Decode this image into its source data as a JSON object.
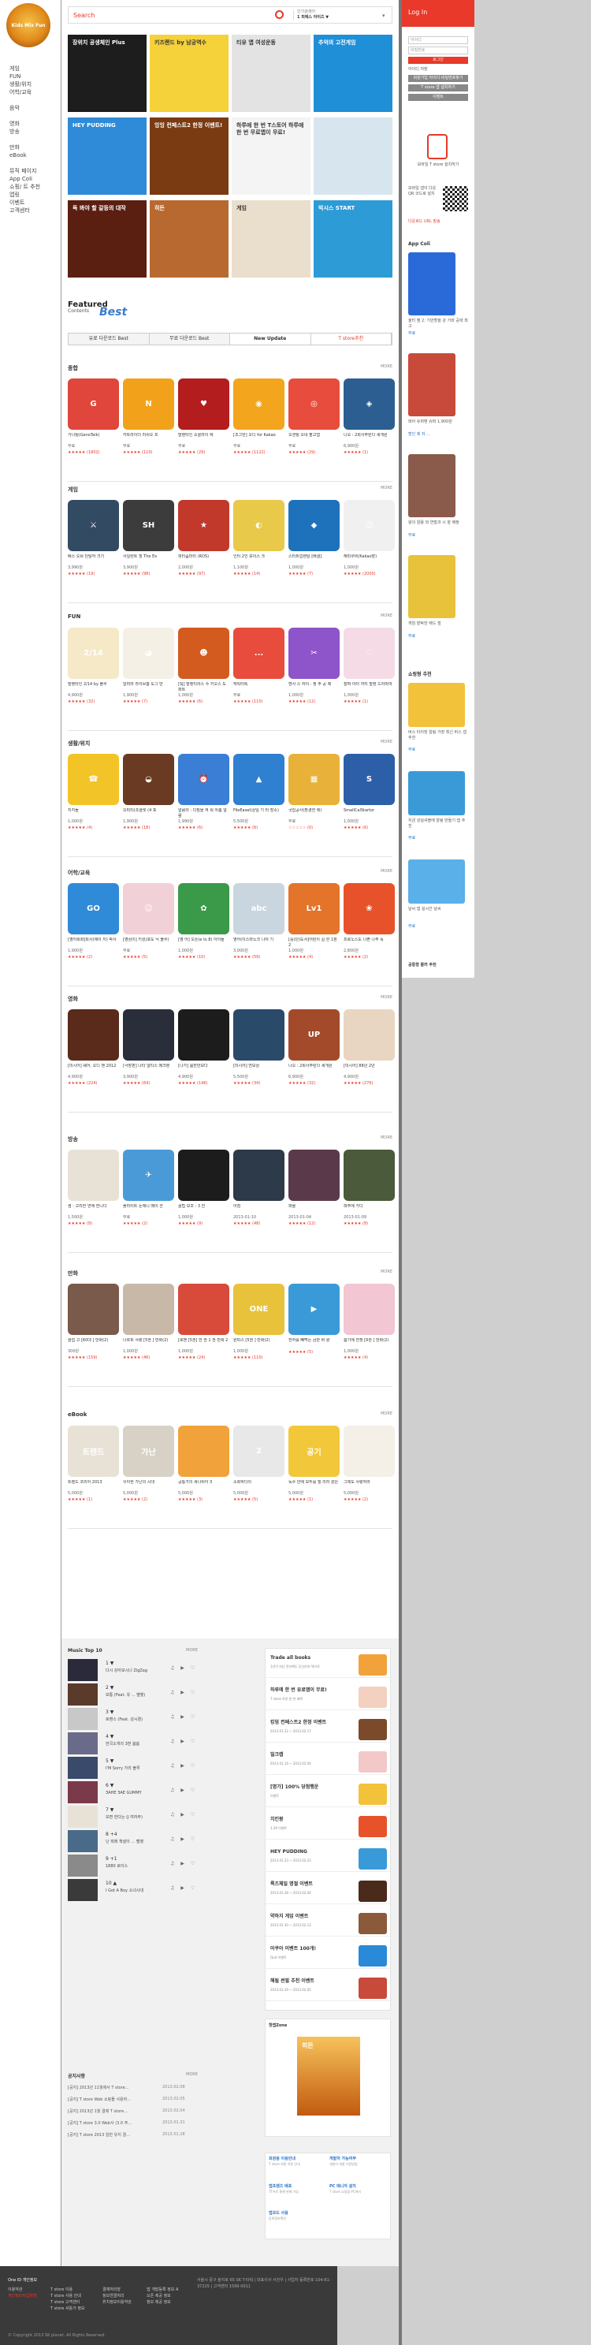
{
  "left_nav": {
    "logo_text": "Kids Mix Fun",
    "items": [
      "게임",
      "FUN",
      "생활/위치",
      "어학/교육"
    ],
    "items2": [
      "음악",
      "영화",
      "방송"
    ],
    "items3": [
      "만화",
      "eBook"
    ],
    "items4": [
      "뮤직 페이지",
      "App Coli",
      "쇼핑/ 트 추천",
      "앱링",
      "이벤트",
      "고객센터"
    ]
  },
  "search": {
    "placeholder": "Search",
    "popular_label": "인기검색어",
    "popular_value": "1 피에스 아이즈 ▼"
  },
  "banners": [
    {
      "text": "장위치 공생체인 Plus",
      "color": "#1d1d1d"
    },
    {
      "text": "키즈랜드 by 남궁역수",
      "color": "#f5d13a"
    },
    {
      "text": "티유 앱 여성운동",
      "color": "#e3e3e3"
    },
    {
      "text": "추억의 고전게임",
      "color": "#1f8fd8"
    },
    {
      "text": "HEY PUDDING",
      "color": "#2f8bd8"
    },
    {
      "text": "잉잉 컨페스트2 한정 이벤트!",
      "color": "#7a3a12"
    },
    {
      "text": "하루에 한 번 T스토어 하루에 한 번 무료앱이 무료!",
      "color": "#f4f4f4"
    },
    {
      "text": "",
      "color": "#d7e6ee"
    },
    {
      "text": "독 봐야 할 갈등의 대작",
      "color": "#5b1f12"
    },
    {
      "text": "히든",
      "color": "#b8692f"
    },
    {
      "text": "게임",
      "color": "#eadfcc"
    },
    {
      "text": "빅시스 START",
      "color": "#2d9bd6"
    }
  ],
  "featured": {
    "title": "Featured",
    "subtitle": "Contents",
    "best": "Best"
  },
  "tabs": [
    "유료 다운로드 Best",
    "무료 다운로드 Best",
    "New Update",
    "T store추천"
  ],
  "sections": [
    {
      "title": "종합",
      "more": "MORE",
      "apps": [
        {
          "name": "가나팅(GenoTalk)",
          "price": "무료",
          "stars": "★★★★★ (1802)",
          "color": "#e0463b",
          "glyph": "G"
        },
        {
          "name": "카트라이더 러쉬오 프",
          "price": "무료",
          "stars": "★★★★★ (110)",
          "color": "#f2a21a",
          "glyph": "N"
        },
        {
          "name": "발렌타인 쇼콜라이 에",
          "price": "무료",
          "stars": "★★★★★ (29)",
          "color": "#b31d1d",
          "glyph": "♥"
        },
        {
          "name": "[조그만] 오디 for Kakao",
          "price": "무료",
          "stars": "★★★★★ (1122)",
          "color": "#f3a51d",
          "glyph": "◉"
        },
        {
          "name": "오센팅 오네 팔고앱",
          "price": "무료",
          "stars": "★★★★★ (29)",
          "color": "#e74c3c",
          "glyph": "◎"
        },
        {
          "name": "니오 : 2회사주린다 세개원",
          "price": "6,900원",
          "stars": "★★★★★ (1)",
          "color": "#2c5e91",
          "glyph": "◈"
        }
      ]
    },
    {
      "title": "게임",
      "more": "MORE",
      "apps": [
        {
          "name": "배스 오브 단탈하 크기",
          "price": "3,990원",
          "stars": "★★★★★ (19)",
          "color": "#334a63",
          "glyph": "⚔"
        },
        {
          "name": "사일런트 힐 The Ex",
          "price": "3,900원",
          "stars": "★★★★★ (98)",
          "color": "#3c3c3c",
          "glyph": "SH"
        },
        {
          "name": "피터줌마리 (ROS)",
          "price": "2,000원",
          "stars": "★★★★★ (97)",
          "color": "#c0392b",
          "glyph": "★"
        },
        {
          "name": "인터 2인 보이스 크",
          "price": "1,100원",
          "stars": "★★★★★ (14)",
          "color": "#e8c94a",
          "glyph": "◐"
        },
        {
          "name": "스타트업렌탈 [배결]",
          "price": "1,000원",
          "stars": "★★★★★ (7)",
          "color": "#1d72bb",
          "glyph": "◆"
        },
        {
          "name": "해피루비(Kakao장)",
          "price": "1,000원",
          "stars": "★★★★★ (2000)",
          "color": "#f0f0f0",
          "glyph": "☺"
        }
      ]
    },
    {
      "title": "FUN",
      "more": "MORE",
      "apps": [
        {
          "name": "발렌타인 2/14 by 블루",
          "price": "4,900원",
          "stars": "★★★★★ (32)",
          "color": "#f6e9c8",
          "glyph": "2/14"
        },
        {
          "name": "달려라 라이브홈 도그 만",
          "price": "1,900원",
          "stars": "★★★★★ (7)",
          "color": "#f5f0e6",
          "glyph": "◕"
        },
        {
          "name": "[SJ] 발렌티라스 수 키오스 도화트",
          "price": "1,000원",
          "stars": "★★★★★ (6)",
          "color": "#d35b1f",
          "glyph": "☻"
        },
        {
          "name": "캐릭터톡",
          "price": "무료",
          "stars": "★★★★★ (110)",
          "color": "#e74c3c",
          "glyph": "..."
        },
        {
          "name": "헨사 스 하이 : 정 주 공 제",
          "price": "1,000원",
          "stars": "★★★★★ (12)",
          "color": "#8e54c9",
          "glyph": "✂"
        },
        {
          "name": "찰짜 이터 까지 발렌 드라마마",
          "price": "1,000원",
          "stars": "★★★★★ (1)",
          "color": "#f4dbe6",
          "glyph": "♡"
        }
      ]
    },
    {
      "title": "생활/위치",
      "more": "MORE",
      "apps": [
        {
          "name": "지지돌",
          "price": "1,000원",
          "stars": "★★★★★ (4)",
          "color": "#f3c428",
          "glyph": "☎"
        },
        {
          "name": "오피티(초콜릿 (4 포",
          "price": "1,900원",
          "stars": "★★★★★ (18)",
          "color": "#6b3a22",
          "glyph": "◒"
        },
        {
          "name": "알람의 : 다짐을 켜 워 아봅 알람",
          "price": "1,990원",
          "stars": "★★★★★ (6)",
          "color": "#3a7fd5",
          "glyph": "⏰"
        },
        {
          "name": "FileEasel(상일 기 타 장소)",
          "price": "5,500원",
          "stars": "★★★★★ (6)",
          "color": "#2f80d0",
          "glyph": "▲"
        },
        {
          "name": "국립공사(환경연 에)",
          "price": "무료",
          "stars": "☆☆☆☆☆ (0)",
          "color": "#e8b23a",
          "glyph": "▦"
        },
        {
          "name": "SmallCalStartor",
          "price": "1,000원",
          "stars": "★★★★★ (6)",
          "color": "#2d5fa8",
          "glyph": "S"
        }
      ]
    },
    {
      "title": "어학/교육",
      "more": "MORE",
      "apps": [
        {
          "name": "[영어회화]회사(에이 지) 박사",
          "price": "1,900원",
          "stars": "★★★★★ (2)",
          "color": "#2f8bd8",
          "glyph": "GO"
        },
        {
          "name": "[영심이] 키성(포도 닉 블루)",
          "price": "무료",
          "stars": "★★★★★ (5)",
          "color": "#f2d0d8",
          "glyph": "☺"
        },
        {
          "name": "[영 어] 오픈(e ts 8) 아이들",
          "price": "1,000원",
          "stars": "★★★★★ (10)",
          "color": "#3a9a4a",
          "glyph": "✿"
        },
        {
          "name": "영어(이스마노크 나아 기",
          "price": "3,000원",
          "stars": "★★★★★ (59)",
          "color": "#c9d6df",
          "glyph": "abc"
        },
        {
          "name": "[중(단)도서]어린이 길 한 1판 2",
          "price": "1,000원",
          "stars": "★★★★★ (4)",
          "color": "#e3742a",
          "glyph": "Lv1"
        },
        {
          "name": "프로노스도 나쁜 나주 독",
          "price": "2,800원",
          "stars": "★★★★★ (2)",
          "color": "#e8522a",
          "glyph": "❀"
        }
      ]
    },
    {
      "title": "영화",
      "more": "MORE",
      "apps": [
        {
          "name": "[미시어] 쉐어, 오디 맨 2012",
          "price": "4,900원",
          "stars": "★★★★★ (224)",
          "color": "#5a2a1a",
          "glyph": ""
        },
        {
          "name": "[극장판] 나타 알티스 메크렌",
          "price": "3,900원",
          "stars": "★★★★★ (64)",
          "color": "#2a2d3a",
          "glyph": ""
        },
        {
          "name": "[나가] 붐한만보다",
          "price": "4,900원",
          "stars": "★★★★★ (146)",
          "color": "#1c1c1c",
          "glyph": ""
        },
        {
          "name": "[미시어] 연보상",
          "price": "5,500원",
          "stars": "★★★★★ (34)",
          "color": "#2a4a6a",
          "glyph": ""
        },
        {
          "name": "나오 : 2회사주린다 세개원",
          "price": "6,900원",
          "stars": "★★★★★ (32)",
          "color": "#a24a2a",
          "glyph": "UP"
        },
        {
          "name": "[미시어] 88년 2년",
          "price": "4,900원",
          "stars": "★★★★★ (276)",
          "color": "#e8d6c2",
          "glyph": ""
        }
      ]
    },
    {
      "title": "방송",
      "more": "MORE",
      "apps": [
        {
          "name": "썸 : 고리한 연애 연니다",
          "price": "1,500원",
          "stars": "★★★★★ (8)",
          "color": "#e8e2d6",
          "glyph": ""
        },
        {
          "name": "플라이트 돈애니 메이 션",
          "price": "무료",
          "stars": "★★★★★ (2)",
          "color": "#4a9ad8",
          "glyph": "✈"
        },
        {
          "name": "꿀팁 보조 : 3 안",
          "price": "1,000원",
          "stars": "★★★★★ (9)",
          "color": "#1c1c1c",
          "glyph": ""
        },
        {
          "name": "아침",
          "price": "2013-01-10",
          "stars": "★★★★★ (48)",
          "color": "#2c3a4a",
          "glyph": ""
        },
        {
          "name": "파울",
          "price": "2013-01-04",
          "stars": "★★★★★ (12)",
          "color": "#5a3a4a",
          "glyph": ""
        },
        {
          "name": "파주에 가다",
          "price": "2013-01-09",
          "stars": "★★★★★ (8)",
          "color": "#4a5a3a",
          "glyph": ""
        }
      ]
    },
    {
      "title": "만화",
      "more": "MORE",
      "apps": [
        {
          "name": "클럽 고 [60대 ] 만화(2)",
          "price": "300원",
          "stars": "★★★★★ (159)",
          "color": "#7a5a4a",
          "glyph": ""
        },
        {
          "name": "나르트 사랑 [5권 ] 만화(2)",
          "price": "1,000원",
          "stars": "★★★★★ (46)",
          "color": "#c8b8a8",
          "glyph": ""
        },
        {
          "name": "[로맨 [5권] 만 권 1 권 만화 2",
          "price": "1,000원",
          "stars": "★★★★★ (24)",
          "color": "#d84a3a",
          "glyph": ""
        },
        {
          "name": "원피스 [5권 ] 만화(2)",
          "price": "1,000원",
          "stars": "★★★★★ (110)",
          "color": "#e8c23a",
          "glyph": "ONE"
        },
        {
          "name": "천하를 빼먹는 금관 바 왕",
          "price": "",
          "stars": "★★★★★ (5)",
          "color": "#3a9ad8",
          "glyph": "▶"
        },
        {
          "name": "봄기에 전쟁 [6권 ] 만화(2)",
          "price": "1,000원",
          "stars": "★★★★★ (4)",
          "color": "#f2c6d2",
          "glyph": ""
        }
      ]
    },
    {
      "title": "eBook",
      "more": "MORE",
      "apps": [
        {
          "name": "트렌드 코리아 2013",
          "price": "5,000원",
          "stars": "★★★★★ (1)",
          "color": "#e8e2d6",
          "glyph": "트렌드"
        },
        {
          "name": "우아한 가난의 시대",
          "price": "5,000원",
          "stars": "★★★★★ (2)",
          "color": "#d8d2c6",
          "glyph": "가난"
        },
        {
          "name": "공통가의 세나비아 3",
          "price": "5,000원",
          "stars": "★★★★★ (3)",
          "color": "#f2a23a",
          "glyph": ""
        },
        {
          "name": "소화하다의",
          "price": "5,000원",
          "stars": "★★★★★ (5)",
          "color": "#e8e8e8",
          "glyph": "2"
        },
        {
          "name": "독수 안에 모두를 빌 리러 같은",
          "price": "5,000원",
          "stars": "★★★★★ (1)",
          "color": "#f2c83a",
          "glyph": "공기"
        },
        {
          "name": "그래도 사랑하라",
          "price": "5,000원",
          "stars": "★★★★★ (2)",
          "color": "#f4f0e8",
          "glyph": ""
        }
      ]
    }
  ],
  "music": {
    "title": "Music Top 10",
    "more": "MORE",
    "tracks": [
      {
        "rank": "1 ▼",
        "title": "다시 강아보시나 ZigZag",
        "color": "#2a2a3a"
      },
      {
        "rank": "2 ▼",
        "title": "보통 (Feat. 유 ... 벨벳)",
        "color": "#5a3a2a"
      },
      {
        "rank": "3 ▼",
        "title": "로맨스 (Feat. 성시경)",
        "color": "#c8c8c8"
      },
      {
        "rank": "4 ▼",
        "title": "한국소개의 3번 봄봄",
        "color": "#6a6a8a"
      },
      {
        "rank": "5 ▼",
        "title": "I'M Sorry 가리 블루",
        "color": "#3a4a6a"
      },
      {
        "rank": "6 ▼",
        "title": "ЗАНЕ ЗАЕ GUMMY",
        "color": "#7a3a4a"
      },
      {
        "rank": "7 ▼",
        "title": "보면 한다는 (J 여자주)",
        "color": "#e8e2d6"
      },
      {
        "rank": "8 +4",
        "title": "난 뭐래 책설이 ... 벨벳",
        "color": "#4a6a8a"
      },
      {
        "rank": "9 +1",
        "title": "1880 로이스",
        "color": "#8a8a8a"
      },
      {
        "rank": "10 ▲",
        "title": "I Got A Boy 소녀시대",
        "color": "#3a3a3a"
      }
    ]
  },
  "promos": [
    {
      "title": "Trade all books",
      "sub": "1년이 지난 전자책도 당신만의 책으로",
      "color": "#f2a23a"
    },
    {
      "title": "하루에 한 번 유료앱이 무료!",
      "sub": "T store 하루 한 번 혜택",
      "color": "#f4d0c0"
    },
    {
      "title": "킹덤 컨페스트2 한정 이벤트",
      "sub": "2013.01.22 ~ 2013.02.17",
      "color": "#7a4a2a"
    },
    {
      "title": "밀크캡",
      "sub": "2013.01.14 ~ 2013.02.04",
      "color": "#f2c8c8"
    },
    {
      "title": "[명가] 100% 당첨행운",
      "sub": "이벤트",
      "color": "#f2c23a"
    },
    {
      "title": "치킨팡",
      "sub": "1.29 이벤트",
      "color": "#e8522a"
    },
    {
      "title": "HEY PUDDING",
      "sub": "2013.01.23 ~ 2013.02.23",
      "color": "#3a9ad8"
    },
    {
      "title": "록츠체일 명절 이벤트",
      "sub": "2013.01.28 ~ 2013.02.04",
      "color": "#4a2a1a"
    },
    {
      "title": "약하지 게임 이벤트",
      "sub": "2013.01.30 ~ 2013.02.13",
      "color": "#8a5a3a"
    },
    {
      "title": "아쿠아 이벤트 100개!",
      "sub": "Quit 이벤트",
      "color": "#2a8ad8"
    },
    {
      "title": "해될 썬필 추천 이벤트",
      "sub": "2013.01.29 ~ 2013.02.05",
      "color": "#c84a3a"
    }
  ],
  "hot": {
    "title": "핫앱Zone",
    "card": "히든"
  },
  "notices": {
    "title": "공지사항",
    "more": "MORE",
    "rows": [
      {
        "text": "[공지] 2013년 11월에서 T store...",
        "date": "2013.02.08"
      },
      {
        "text": "[공지] T store Web 쇼핑몰 사용하...",
        "date": "2013.02.05"
      },
      {
        "text": "[공지] 2013년 1월 결제 T store...",
        "date": "2013.02.04"
      },
      {
        "text": "[공지] T store 3.0 Web사 (3.0 주...",
        "date": "2013.01.31"
      },
      {
        "text": "[공지] T store 2013 일반 유지 결...",
        "date": "2013.01.28"
      }
    ]
  },
  "quick_links": [
    {
      "a": "회원용 이용안내",
      "b": "T store 회원 약정 안내"
    },
    {
      "a": "개발자 가능여부",
      "b": "개발자 개발 이용방법"
    },
    {
      "a": "앱프렌즈 배포",
      "b": "TT프로 통해 판매 가능"
    },
    {
      "a": "PC 매니저 설치",
      "b": "T store 쇼핑을 PC에서"
    },
    {
      "a": "앱코드 사용",
      "b": "등록정보확인"
    },
    {
      "a": "",
      "b": ""
    }
  ],
  "footer": {
    "logo": "One ID 개인정보",
    "col1": [
      "이용약관",
      "개인정보취급방침"
    ],
    "col2": [
      "T store 이용",
      "T store 사용 안내",
      "T store 고객센터",
      "T store 셔틀가 정보"
    ],
    "col3": [
      "결재처리장",
      "정보연결처리",
      "위치정보이용약관"
    ],
    "col4": [
      "앱 개발등록 정보 A",
      "오픈 제공 정보",
      "정보 제공 정보"
    ],
    "copyright": "© Copyright 2013 SK planet. All Rights Reserved.",
    "info": "서울시 중구 을지로 65 SK T-타워 | 대표이사 서진우 | 사업자 등록번호 104-81-37225 | 고객센터 1599-0011"
  },
  "sidebar": {
    "login_label": "Log In",
    "id_placeholder": "아이디",
    "pw_placeholder": "비밀번호",
    "login_btn": "로그인",
    "remember": "아이디 저장",
    "join_btn": "회원가입 아이디·비밀번호찾기",
    "btn2": "T store 앱 설치하기",
    "btn3": "이벤트",
    "phone_caption": "모바일 T store 설치하기",
    "qr_caption": "모바일 앱이 다운 QR 코드로 설치",
    "qr_sub": "다운로드 URL 발송",
    "coil_title": "App Coli",
    "coil_items": [
      {
        "text": "울티 잼 2: 기만할을 강 가와 공략 최고",
        "price": "무료"
      },
      {
        "text": "레아 슈퍼맨 슈퍼 1,900원",
        "price": "할인 제 자 ..."
      },
      {
        "text": "왕의 알람 외 연말과 시 잘 배정",
        "price": "무료"
      },
      {
        "text": "게임 발탁한 애드 점",
        "price": "무료"
      }
    ],
    "shop_title": "쇼핑형 추천",
    "shop_items": [
      {
        "text": "버스 타이밍 알림 가장 최신 버스 앱 추천",
        "price": "무료"
      },
      {
        "text": "지금 성실셔블에 알림 만들기 앱 추천",
        "price": "무료"
      },
      {
        "text": "날씨 앱 실시간 날씨",
        "price": "무료"
      }
    ],
    "tail_title": "공통형 플러 추천",
    "tail_text": "공통형 플러 추천 인기 앱 모음"
  }
}
